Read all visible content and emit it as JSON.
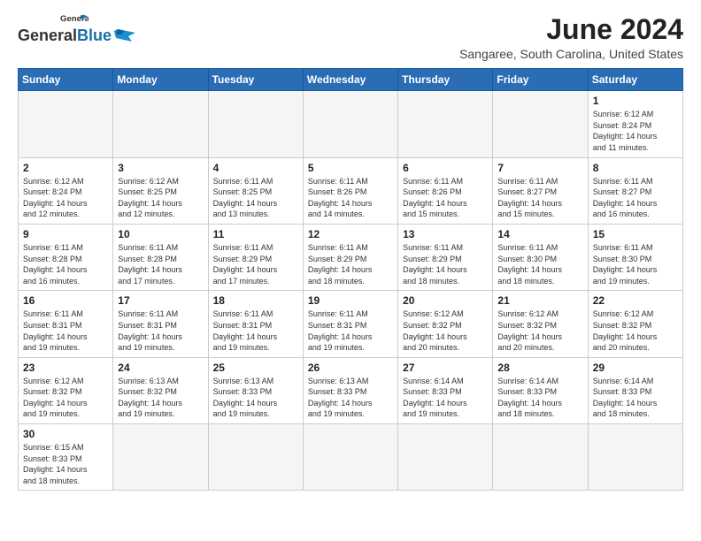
{
  "header": {
    "logo_general": "General",
    "logo_blue": "Blue",
    "month_title": "June 2024",
    "location": "Sangaree, South Carolina, United States"
  },
  "days_of_week": [
    "Sunday",
    "Monday",
    "Tuesday",
    "Wednesday",
    "Thursday",
    "Friday",
    "Saturday"
  ],
  "weeks": [
    [
      {
        "day": "",
        "info": ""
      },
      {
        "day": "",
        "info": ""
      },
      {
        "day": "",
        "info": ""
      },
      {
        "day": "",
        "info": ""
      },
      {
        "day": "",
        "info": ""
      },
      {
        "day": "",
        "info": ""
      },
      {
        "day": "1",
        "info": "Sunrise: 6:12 AM\nSunset: 8:24 PM\nDaylight: 14 hours\nand 11 minutes."
      }
    ],
    [
      {
        "day": "2",
        "info": "Sunrise: 6:12 AM\nSunset: 8:24 PM\nDaylight: 14 hours\nand 12 minutes."
      },
      {
        "day": "3",
        "info": "Sunrise: 6:12 AM\nSunset: 8:25 PM\nDaylight: 14 hours\nand 12 minutes."
      },
      {
        "day": "4",
        "info": "Sunrise: 6:11 AM\nSunset: 8:25 PM\nDaylight: 14 hours\nand 13 minutes."
      },
      {
        "day": "5",
        "info": "Sunrise: 6:11 AM\nSunset: 8:26 PM\nDaylight: 14 hours\nand 14 minutes."
      },
      {
        "day": "6",
        "info": "Sunrise: 6:11 AM\nSunset: 8:26 PM\nDaylight: 14 hours\nand 15 minutes."
      },
      {
        "day": "7",
        "info": "Sunrise: 6:11 AM\nSunset: 8:27 PM\nDaylight: 14 hours\nand 15 minutes."
      },
      {
        "day": "8",
        "info": "Sunrise: 6:11 AM\nSunset: 8:27 PM\nDaylight: 14 hours\nand 16 minutes."
      }
    ],
    [
      {
        "day": "9",
        "info": "Sunrise: 6:11 AM\nSunset: 8:28 PM\nDaylight: 14 hours\nand 16 minutes."
      },
      {
        "day": "10",
        "info": "Sunrise: 6:11 AM\nSunset: 8:28 PM\nDaylight: 14 hours\nand 17 minutes."
      },
      {
        "day": "11",
        "info": "Sunrise: 6:11 AM\nSunset: 8:29 PM\nDaylight: 14 hours\nand 17 minutes."
      },
      {
        "day": "12",
        "info": "Sunrise: 6:11 AM\nSunset: 8:29 PM\nDaylight: 14 hours\nand 18 minutes."
      },
      {
        "day": "13",
        "info": "Sunrise: 6:11 AM\nSunset: 8:29 PM\nDaylight: 14 hours\nand 18 minutes."
      },
      {
        "day": "14",
        "info": "Sunrise: 6:11 AM\nSunset: 8:30 PM\nDaylight: 14 hours\nand 18 minutes."
      },
      {
        "day": "15",
        "info": "Sunrise: 6:11 AM\nSunset: 8:30 PM\nDaylight: 14 hours\nand 19 minutes."
      }
    ],
    [
      {
        "day": "16",
        "info": "Sunrise: 6:11 AM\nSunset: 8:31 PM\nDaylight: 14 hours\nand 19 minutes."
      },
      {
        "day": "17",
        "info": "Sunrise: 6:11 AM\nSunset: 8:31 PM\nDaylight: 14 hours\nand 19 minutes."
      },
      {
        "day": "18",
        "info": "Sunrise: 6:11 AM\nSunset: 8:31 PM\nDaylight: 14 hours\nand 19 minutes."
      },
      {
        "day": "19",
        "info": "Sunrise: 6:11 AM\nSunset: 8:31 PM\nDaylight: 14 hours\nand 19 minutes."
      },
      {
        "day": "20",
        "info": "Sunrise: 6:12 AM\nSunset: 8:32 PM\nDaylight: 14 hours\nand 20 minutes."
      },
      {
        "day": "21",
        "info": "Sunrise: 6:12 AM\nSunset: 8:32 PM\nDaylight: 14 hours\nand 20 minutes."
      },
      {
        "day": "22",
        "info": "Sunrise: 6:12 AM\nSunset: 8:32 PM\nDaylight: 14 hours\nand 20 minutes."
      }
    ],
    [
      {
        "day": "23",
        "info": "Sunrise: 6:12 AM\nSunset: 8:32 PM\nDaylight: 14 hours\nand 19 minutes."
      },
      {
        "day": "24",
        "info": "Sunrise: 6:13 AM\nSunset: 8:32 PM\nDaylight: 14 hours\nand 19 minutes."
      },
      {
        "day": "25",
        "info": "Sunrise: 6:13 AM\nSunset: 8:33 PM\nDaylight: 14 hours\nand 19 minutes."
      },
      {
        "day": "26",
        "info": "Sunrise: 6:13 AM\nSunset: 8:33 PM\nDaylight: 14 hours\nand 19 minutes."
      },
      {
        "day": "27",
        "info": "Sunrise: 6:14 AM\nSunset: 8:33 PM\nDaylight: 14 hours\nand 19 minutes."
      },
      {
        "day": "28",
        "info": "Sunrise: 6:14 AM\nSunset: 8:33 PM\nDaylight: 14 hours\nand 18 minutes."
      },
      {
        "day": "29",
        "info": "Sunrise: 6:14 AM\nSunset: 8:33 PM\nDaylight: 14 hours\nand 18 minutes."
      }
    ],
    [
      {
        "day": "30",
        "info": "Sunrise: 6:15 AM\nSunset: 8:33 PM\nDaylight: 14 hours\nand 18 minutes."
      },
      {
        "day": "",
        "info": ""
      },
      {
        "day": "",
        "info": ""
      },
      {
        "day": "",
        "info": ""
      },
      {
        "day": "",
        "info": ""
      },
      {
        "day": "",
        "info": ""
      },
      {
        "day": "",
        "info": ""
      }
    ]
  ]
}
